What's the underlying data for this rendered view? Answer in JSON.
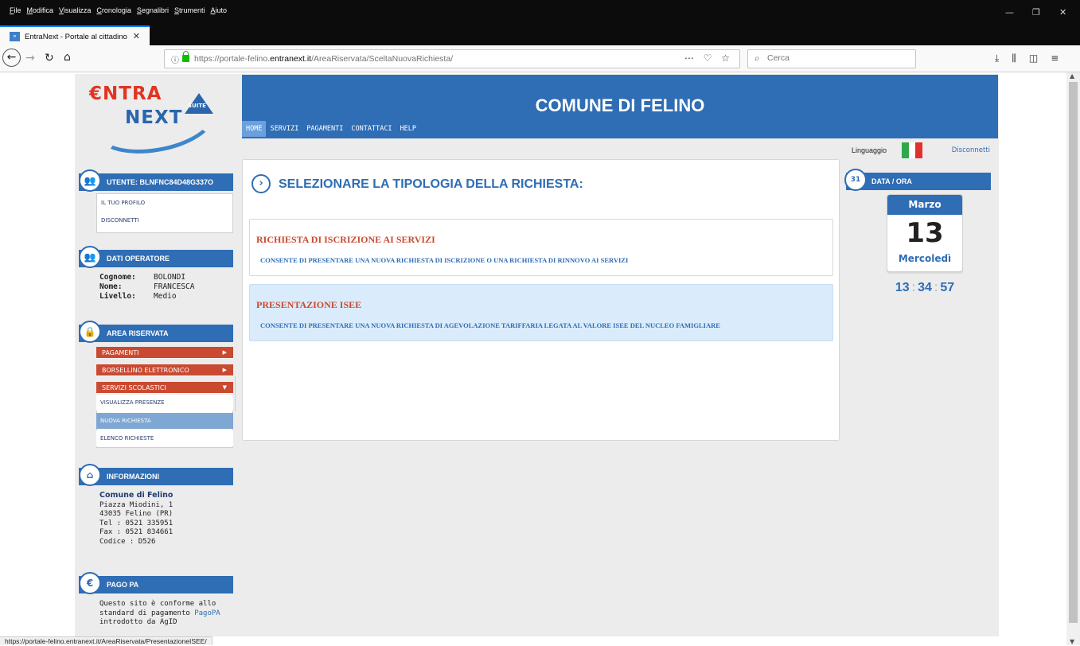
{
  "browser": {
    "menus": [
      "File",
      "Modifica",
      "Visualizza",
      "Cronologia",
      "Segnalibri",
      "Strumenti",
      "Aiuto"
    ],
    "tab_title": "EntraNext - Portale al cittadino",
    "url_prefix": "https://portale-felino.",
    "url_domain": "entranext.it",
    "url_path": "/AreaRiservata/SceltaNuovaRichiesta/",
    "search_placeholder": "Cerca",
    "status_url": "https://portale-felino.entranext.it/AreaRiservata/PresentazioneISEE/"
  },
  "logo": {
    "entra": "€NTRA",
    "next": "NEXT",
    "suite": "SUITE"
  },
  "header": {
    "title": "COMUNE DI FELINO",
    "nav": [
      "HOME",
      "SERVIZI",
      "PAGAMENTI",
      "CONTATTACI",
      "HELP"
    ],
    "language_label": "Linguaggio",
    "logout": "Disconnetti"
  },
  "sidebar": {
    "user_title": "UTENTE: BLNFNC84D48G337O",
    "user_links": [
      "IL TUO PROFILO",
      "DISCONNETTI"
    ],
    "operator_title": "DATI OPERATORE",
    "operator": {
      "cognome_label": "Cognome:",
      "cognome": "BOLONDI",
      "nome_label": "Nome:",
      "nome": "FRANCESCA",
      "livello_label": "Livello:",
      "livello": "Medio"
    },
    "area_title": "AREA RISERVATA",
    "area_menus": [
      "PAGAMENTI",
      "BORSELLINO ELETTRONICO",
      "SERVIZI SCOLASTICI"
    ],
    "area_subitems": [
      "VISUALIZZA PRESENZE",
      "NUOVA RICHIESTA",
      "ELENCO RICHIESTE"
    ],
    "info_title": "INFORMAZIONI",
    "info": {
      "name": "Comune di Felino",
      "address": "Piazza Miodini, 1",
      "city": "43035 Felino (PR)",
      "tel": "Tel : 0521 335951",
      "fax": "Fax : 0521 834661",
      "codice": "Codice : D526"
    },
    "pagopa_title": "PAGO PA",
    "pagopa_text_1": "Questo sito è conforme allo",
    "pagopa_text_2": "standard di pagamento",
    "pagopa_link": "PagoPA",
    "pagopa_text_3": "introdotto da AgID"
  },
  "main": {
    "heading": "SELEZIONARE LA TIPOLOGIA DELLA RICHIESTA:",
    "cards": [
      {
        "title": "RICHIESTA DI ISCRIZIONE AI SERVIZI",
        "desc": "CONSENTE DI PRESENTARE UNA NUOVA RICHIESTA DI ISCRIZIONE O UNA RICHIESTA DI RINNOVO AI SERVIZI"
      },
      {
        "title": "PRESENTAZIONE ISEE",
        "desc": "CONSENTE DI PRESENTARE UNA NUOVA RICHIESTA DI AGEVOLAZIONE TARIFFARIA LEGATA AL VALORE ISEE DEL NUCLEO FAMIGLIARE"
      }
    ]
  },
  "datetime": {
    "title": "DATA / ORA",
    "month": "Marzo",
    "day": "13",
    "weekday": "Mercoledì",
    "hh": "13",
    "mm": "34",
    "ss": "57"
  },
  "colors": {
    "primary": "#2f6db5",
    "accent_red": "#c94a31",
    "highlight": "#daebfb"
  }
}
